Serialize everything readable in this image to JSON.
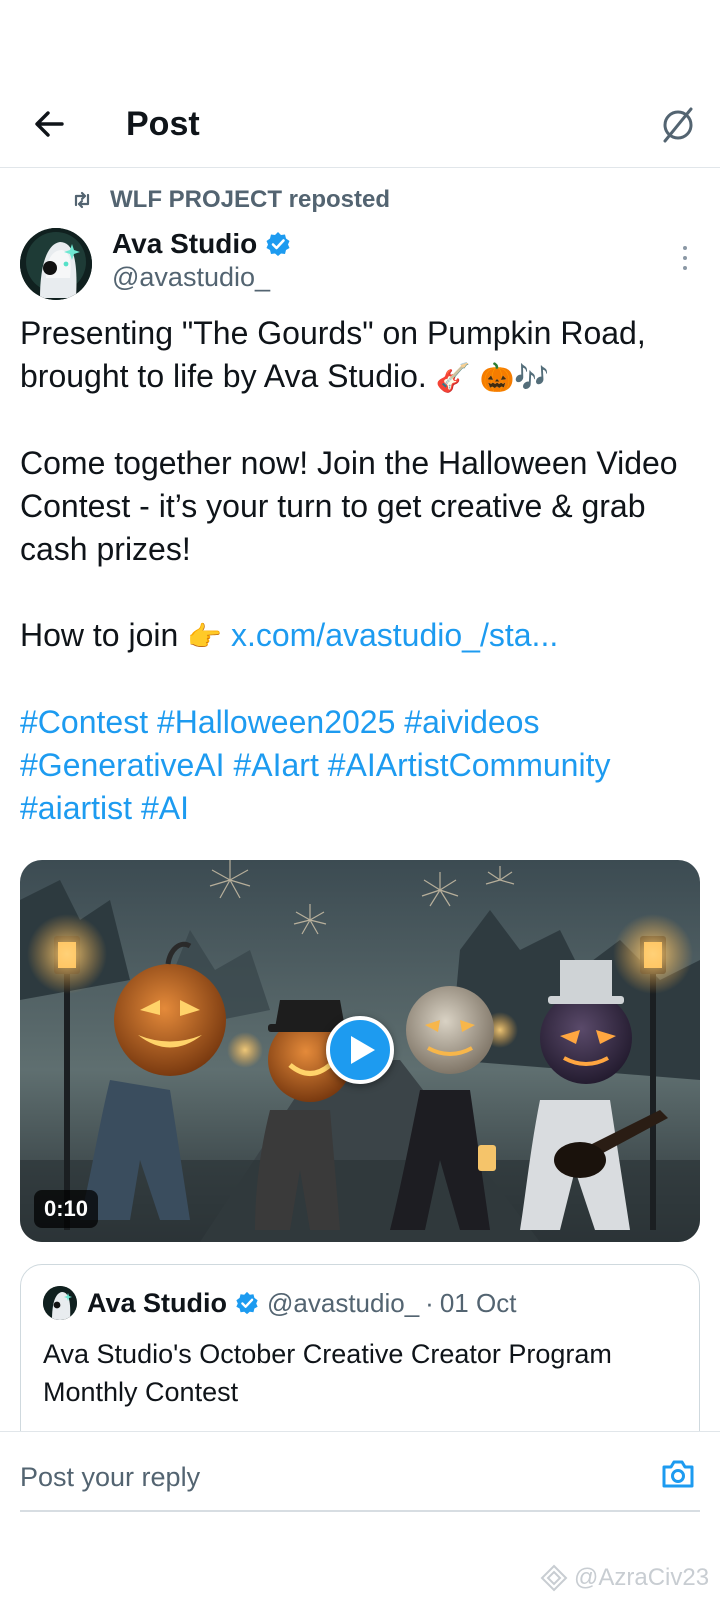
{
  "header": {
    "title": "Post",
    "back_icon": "arrow-left-icon",
    "settings_icon": "slashed-circle-icon"
  },
  "repost": {
    "icon": "repost-icon",
    "text": "WLF PROJECT reposted"
  },
  "post": {
    "author_name": "Ava Studio",
    "author_handle": "@avastudio_",
    "verified_icon": "verified-badge-icon",
    "line1": "Presenting \"The Gourds\" on Pumpkin Road, brought to life by Ava Studio.",
    "line1_emoji": "🎸 🎃🎶",
    "para2": "Come together now! Join the Halloween Video Contest - it’s your turn to get creative & grab cash prizes!",
    "how_to_join": "How to join",
    "pointing_emoji": "👉",
    "link": "x.com/avastudio_/sta...",
    "hashtags": [
      "#Contest",
      "#Halloween2025",
      "#aivideos",
      "#GenerativeAI",
      "#AIart",
      "#AIArtistCommunity",
      "#aiartist",
      "#AI"
    ]
  },
  "media": {
    "duration": "0:10",
    "play_icon": "play-icon"
  },
  "quote": {
    "author_name": "Ava Studio",
    "author_handle": "@avastudio_",
    "separator": "·",
    "date": "01 Oct",
    "text": "Ava Studio's October Creative Creator Program Monthly Contest"
  },
  "reply": {
    "placeholder": "Post your reply",
    "camera_icon": "camera-icon"
  },
  "watermark": {
    "text": "@AzraCiv23"
  },
  "colors": {
    "link": "#1d9bf0",
    "secondary_text": "#536471",
    "primary_text": "#0f1419",
    "divider": "#e1e6ea"
  }
}
